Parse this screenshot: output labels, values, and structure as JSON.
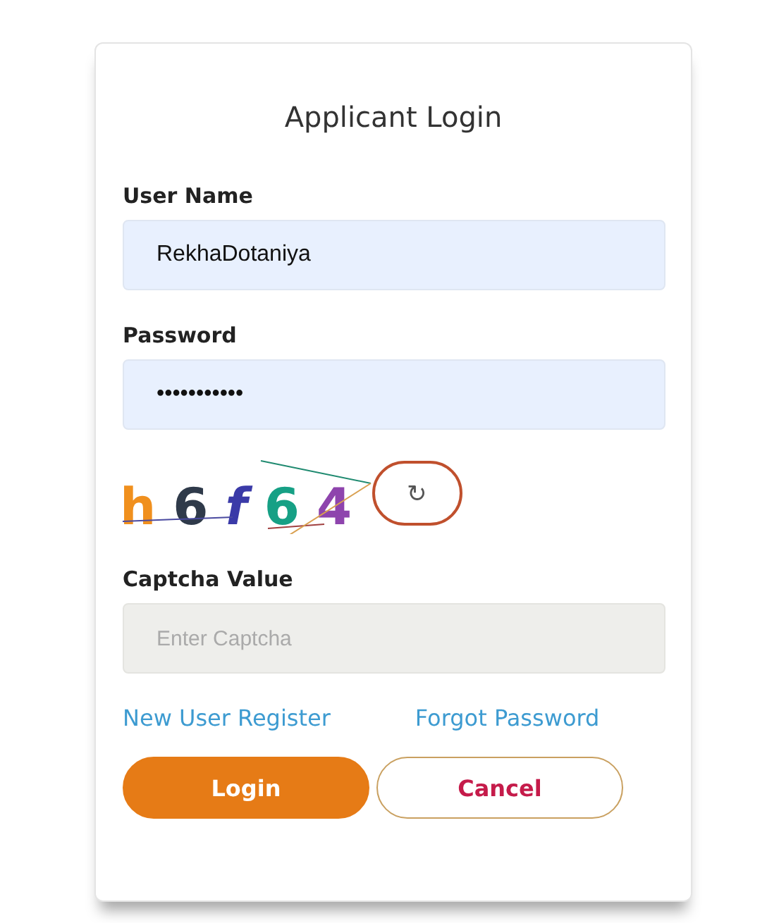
{
  "title": "Applicant Login",
  "fields": [
    {
      "label": "User Name",
      "value": "RekhaDotaniya"
    },
    {
      "label": "Password",
      "value": "•••••••••••"
    }
  ],
  "captcha": {
    "characters": [
      {
        "char": "h",
        "color": "#f0901e"
      },
      {
        "char": "6",
        "color": "#2f3a4a"
      },
      {
        "char": "f",
        "color": "#3a3aa8"
      },
      {
        "char": "6",
        "color": "#16a085"
      },
      {
        "char": "4",
        "color": "#8e44ad"
      }
    ],
    "refresh": "↻"
  },
  "captcha_field": {
    "label": "Captcha Value",
    "placeholder": "Enter Captcha"
  },
  "links": [
    "New User Register",
    "Forgot Password"
  ],
  "buttons": [
    {
      "label": "Login",
      "kind": "primary"
    },
    {
      "label": "Cancel",
      "kind": "secondary"
    }
  ]
}
